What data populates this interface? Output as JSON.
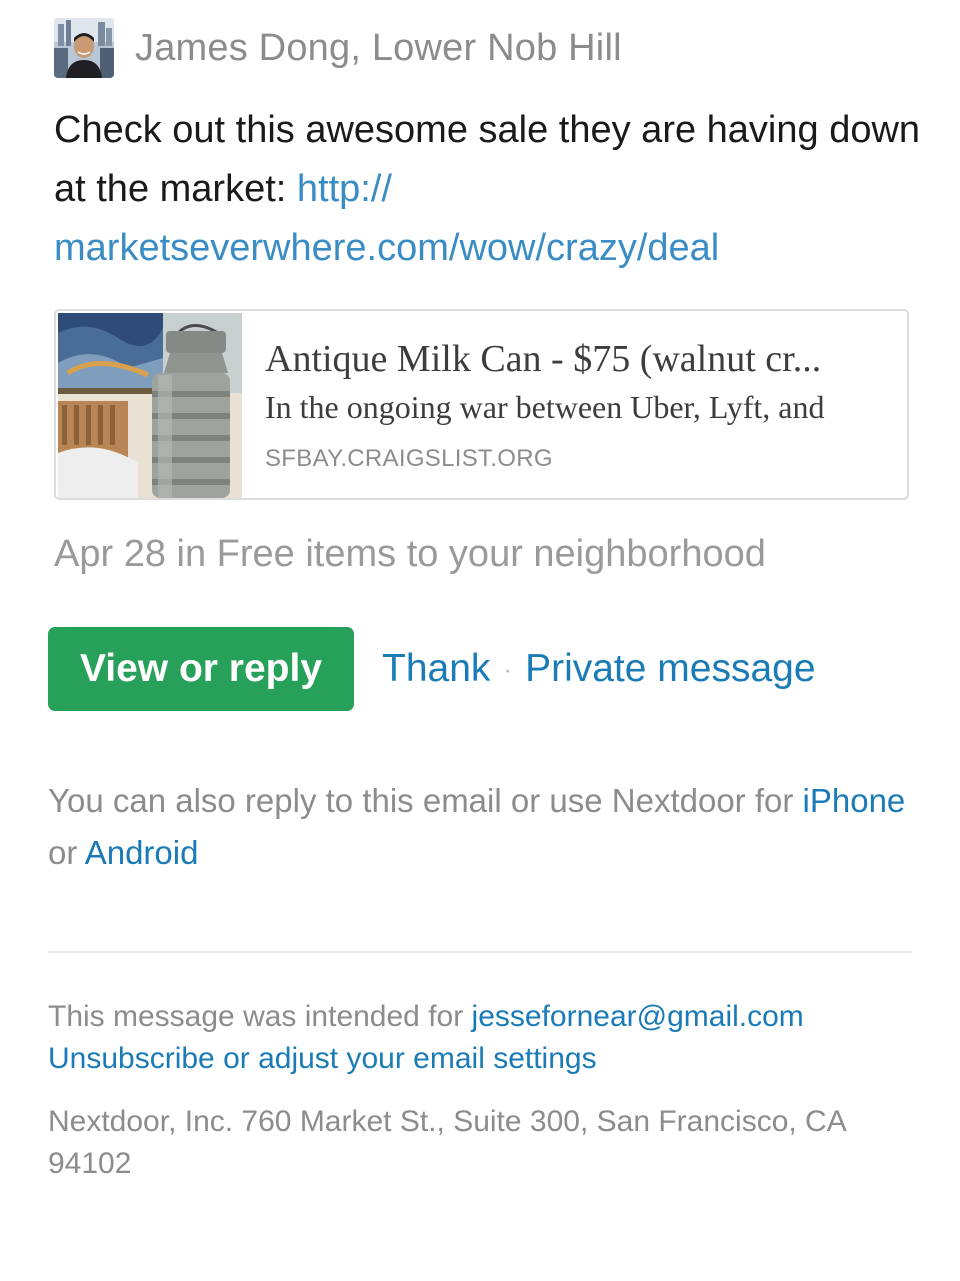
{
  "author": {
    "name": "James Dong, Lower Nob Hill",
    "avatar_icon": "user-avatar"
  },
  "post": {
    "text": "Check out this awesome sale they are having down at the market: ",
    "link_line1": "http://",
    "link_line2": "marketseverwhere.com/wow/crazy/deal"
  },
  "link_card": {
    "title": "Antique Milk Can - $75 (walnut cr...",
    "description": "In the ongoing war between Uber, Lyft, and",
    "domain": "SFBAY.CRAIGSLIST.ORG",
    "thumbnail_icon": "milk-can-image"
  },
  "meta": {
    "text": "Apr 28 in Free items to your neighborhood"
  },
  "actions": {
    "view_reply": "View or reply",
    "thank": "Thank",
    "separator": "·",
    "private_message": "Private message"
  },
  "app_note": {
    "text": "You can also reply to this email or use Nextdoor for ",
    "iphone": "iPhone",
    "or": " or ",
    "android": "Android"
  },
  "footer": {
    "intended_prefix": "This message was intended for ",
    "email": "jessefornear@gmail.com",
    "unsubscribe": "Unsubscribe or adjust your email settings",
    "address": "Nextdoor, Inc. 760 Market St., Suite 300, San Francisco, CA 94102"
  },
  "colors": {
    "button_green": "#27a05a",
    "link_blue": "#1a7bb7",
    "post_link_blue": "#3a8cc5",
    "muted_gray": "#8c8c8c"
  }
}
